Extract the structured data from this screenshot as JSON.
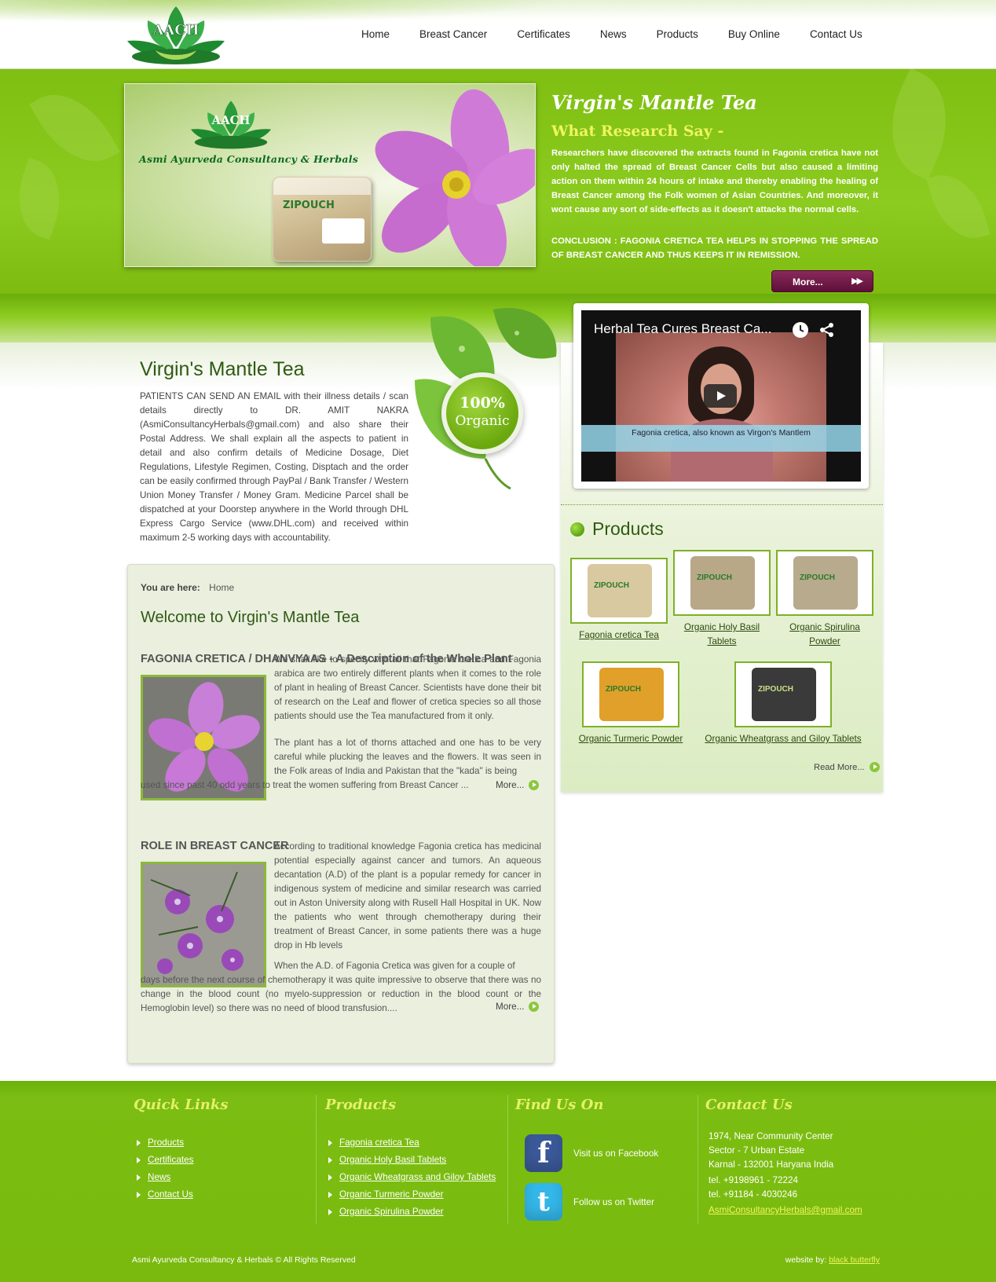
{
  "header": {
    "logo_text": "AACH",
    "nav": [
      "Home",
      "Breast Cancer",
      "Certificates",
      "News",
      "Products",
      "Buy Online",
      "Contact Us"
    ]
  },
  "hero": {
    "brand": "Asmi Ayurveda Consultancy & Herbals",
    "pouch_label": "ZIPOUCH",
    "title": "Virgin's Mantle Tea",
    "subtitle": "What Research Say -",
    "text": "Researchers have discovered the extracts found in Fagonia cretica have not only halted the spread of Breast Cancer Cells but also caused a limiting action on them within 24 hours of intake and thereby enabling the healing of Breast Cancer among the Folk women of Asian Countries. And moreover, it wont cause any sort of side-effects as it doesn't attacks the normal cells.",
    "conclusion": "CONCLUSION : FAGONIA CRETICA TEA HELPS IN STOPPING THE SPREAD OF BREAST CANCER AND THUS KEEPS IT IN REMISSION.",
    "more_label": "More..."
  },
  "intro": {
    "title": "Virgin's Mantle Tea",
    "text": "PATIENTS CAN SEND AN EMAIL with their illness details / scan details directly to DR. AMIT NAKRA (AsmiConsultancyHerbals@gmail.com) and also share their Postal Address. We shall explain all the aspects to patient in detail and also confirm details of Medicine Dosage, Diet Regulations, Lifestyle Regimen, Costing, Disptach and the order can be easily confirmed through PayPal / Bank Transfer / Western Union Money Transfer / Money Gram. Medicine Parcel shall be dispatched at your Doorstep anywhere in the World through DHL Express Cargo Service (www.DHL.com) and received within maximum 2-5 working days with accountability.",
    "badge_pct": "100%",
    "badge_word": "Organic"
  },
  "content": {
    "breadcrumb_label": "You are here:",
    "breadcrumb_current": "Home",
    "welcome": "Welcome to Virgin's Mantle Tea",
    "section1": {
      "title": "FAGONIA CRETICA / DHANVYAAS - A Description of the Whole Plant",
      "p1": "We shall like to specify with all that Fagonia cretica and Fagonia arabica are two entirely different plants when it comes to the role of plant in healing of Breast Cancer. Scientists have done their bit of research on the Leaf and flower of cretica species so all those patients should use the Tea manufactured from it only.",
      "p2a": "The plant has a lot of thorns attached and one has to be very careful while plucking the leaves and the flowers. It was seen in the Folk areas of India and Pakistan that the \"kada\" is being",
      "p2b": "used since past 40 odd years to treat the women suffering from Breast Cancer ...",
      "more": "More..."
    },
    "section2": {
      "title": "ROLE IN BREAST CANCER",
      "p1": "According to traditional knowledge Fagonia cretica has medicinal potential especially against cancer and tumors. An aqueous decantation (A.D) of the plant is a popular remedy for cancer in indigenous system of medicine and similar research was carried out in Aston University along with Rusell Hall Hospital in UK. Now the patients who went through chemotherapy during their treatment of Breast Cancer, in some patients there was a huge drop in Hb levels",
      "p2a": "When the A.D. of Fagonia Cretica was given for a couple of",
      "p2b": "days before the next course of chemotherapy it was quite impressive to observe that there was no change in the blood count (no myelo-suppression or reduction in the blood count or the Hemoglobin level) so there was no need of blood transfusion....",
      "more": "More..."
    }
  },
  "video": {
    "title": "Herbal Tea Cures Breast Ca...",
    "caption": "Fagonia cretica, also known as Virgon's Mantlem"
  },
  "products": {
    "heading": "Products",
    "items": [
      {
        "label": "Fagonia cretica Tea",
        "pouch": "ZIPOUCH",
        "color": "#d9c9a0"
      },
      {
        "label": "Organic Holy Basil Tablets",
        "pouch": "ZIPOUCH",
        "color": "#b8a888"
      },
      {
        "label": "Organic Spirulina Powder",
        "pouch": "ZIPOUCH",
        "color": "#b8aa8c"
      },
      {
        "label": "Organic Turmeric Powder",
        "pouch": "ZIPOUCH",
        "color": "#e0a02a"
      },
      {
        "label": "Organic Wheatgrass and Giloy Tablets",
        "pouch": "ZIPOUCH",
        "color": "#3a3a3a"
      }
    ],
    "read_more": "Read More..."
  },
  "footer": {
    "quick_links": {
      "heading": "Quick Links",
      "items": [
        "Products",
        "Certificates",
        "News",
        "Contact Us"
      ]
    },
    "products": {
      "heading": "Products",
      "items": [
        "Fagonia cretica Tea",
        "Organic Holy Basil Tablets",
        "Organic Wheatgrass and Giloy Tablets",
        "Organic Turmeric Powder",
        "Organic Spirulina Powder"
      ]
    },
    "find_us": {
      "heading": "Find Us On",
      "facebook_icon": "f",
      "twitter_icon": "t",
      "facebook": "Visit us on Facebook",
      "twitter": "Follow us on Twitter"
    },
    "contact": {
      "heading": "Contact Us",
      "address1": "1974, Near Community Center",
      "address2": "Sector - 7 Urban Estate",
      "address3": "Karnal - 132001 Haryana India",
      "tel1": "tel. +9198961 - 72224",
      "tel2": "tel. +91184 - 4030246",
      "email": "AsmiConsultancyHerbals@gmail.com"
    },
    "copyright": "Asmi Ayurveda Consultancy & Herbals © All Rights Reserved",
    "credit_label": "website by:",
    "credit_link": "black butterfly"
  },
  "colors": {
    "accent_green": "#7fbf12",
    "heading_green": "#2f5a13",
    "button_plum": "#6e1a46",
    "footer_heading": "#e6f06a"
  }
}
